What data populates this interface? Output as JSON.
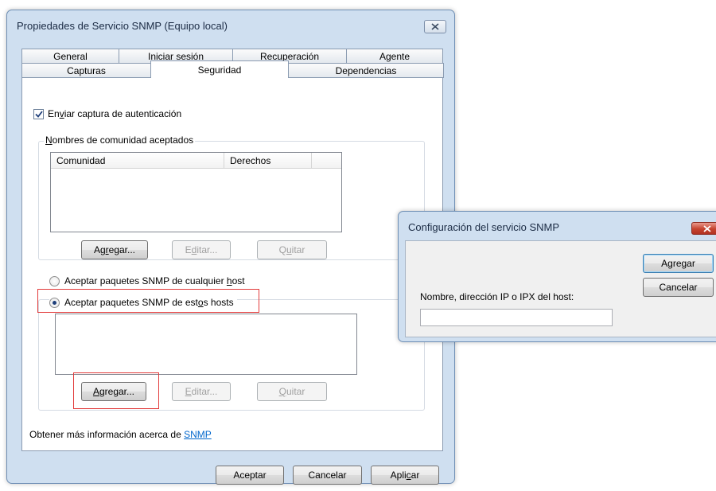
{
  "window": {
    "title": "Propiedades de Servicio SNMP (Equipo local)"
  },
  "tabs_row1": [
    {
      "label": "General"
    },
    {
      "label": "Iniciar sesión"
    },
    {
      "label": "Recuperación"
    },
    {
      "label": "Agente"
    }
  ],
  "tabs_row2": [
    {
      "label": "Capturas"
    },
    {
      "label": "Seguridad",
      "selected": true
    },
    {
      "label": "Dependencias"
    }
  ],
  "security": {
    "auth_trap": {
      "pre": "En",
      "key": "v",
      "post": "iar captura de autenticación",
      "checked": true
    },
    "communities_group": {
      "key": "N",
      "post": "ombres de comunidad aceptados"
    },
    "columns": [
      "Comunidad",
      "Derechos"
    ],
    "buttons1": {
      "add": {
        "pre": "Ag",
        "key": "r",
        "post": "egar..."
      },
      "edit": {
        "pre": "E",
        "key": "d",
        "post": "itar..."
      },
      "remove": {
        "pre": "Q",
        "key": "u",
        "post": "itar"
      }
    },
    "radio_any": {
      "pre": "Aceptar paquetes SNMP de cualquier ",
      "key": "h",
      "post": "ost",
      "selected": false
    },
    "radio_these": {
      "pre": "Aceptar paquetes SNMP de est",
      "key": "o",
      "post": "s hosts",
      "selected": true
    },
    "buttons2": {
      "add": {
        "key": "A",
        "post": "gregar..."
      },
      "edit": {
        "key": "E",
        "post": "ditar..."
      },
      "remove": {
        "key": "Q",
        "post": "uitar"
      }
    },
    "info_text": "Obtener más información acerca de ",
    "info_link": "SNMP"
  },
  "footer": {
    "ok": "Aceptar",
    "cancel": "Cancelar",
    "apply": {
      "pre": "Apli",
      "key": "c",
      "post": "ar"
    }
  },
  "dialog": {
    "title": "Configuración del servicio SNMP",
    "field_label": "Nombre, dirección IP o IPX del host:",
    "field_value": "",
    "add": "Agregar",
    "cancel": "Cancelar"
  },
  "colors": {
    "highlight": "#e23b3b",
    "link": "#0066cc",
    "window_frame": "#cfdff0"
  },
  "icons": [
    "close-icon",
    "checkmark-icon",
    "radio-dot-icon"
  ]
}
